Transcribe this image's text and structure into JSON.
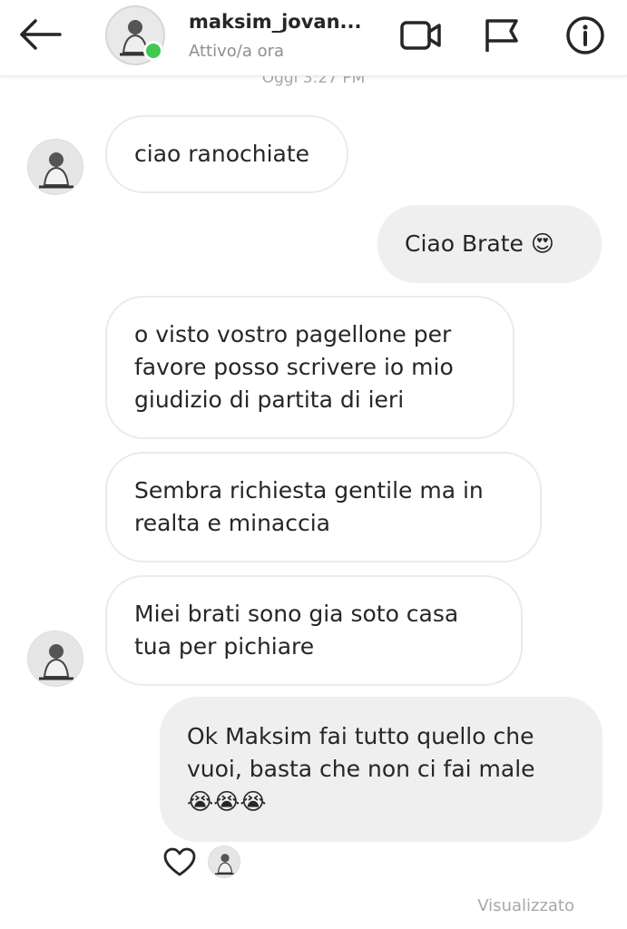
{
  "header": {
    "username": "maksim_jovan...",
    "status": "Attivo/a ora"
  },
  "timestamp": "Oggi 3:27 PM",
  "messages": [
    {
      "direction": "in",
      "text": "ciao ranochiate"
    },
    {
      "direction": "out",
      "text": "Ciao Brate 😍"
    },
    {
      "direction": "in",
      "text": "o visto vostro pagellone per\nfavore posso scrivere io mio\ngiudizio di partita di ieri"
    },
    {
      "direction": "in",
      "text": "Sembra richiesta gentile ma in\nrealta e minaccia"
    },
    {
      "direction": "in",
      "text": "Miei brati sono gia soto casa\ntua per pichiare"
    },
    {
      "direction": "out",
      "text": "Ok Maksim fai tutto quello che\nvuoi, basta che non ci fai male\n😭😭😭"
    }
  ],
  "footer": {
    "seen_label": "Visualizzato"
  },
  "colors": {
    "online": "#41c84e",
    "outgoing_bubble": "#efefef",
    "incoming_border": "#ebebeb",
    "muted_text": "#8e8e8e"
  },
  "icons": [
    "back-arrow-icon",
    "video-call-icon",
    "flag-icon",
    "info-icon",
    "heart-icon"
  ]
}
